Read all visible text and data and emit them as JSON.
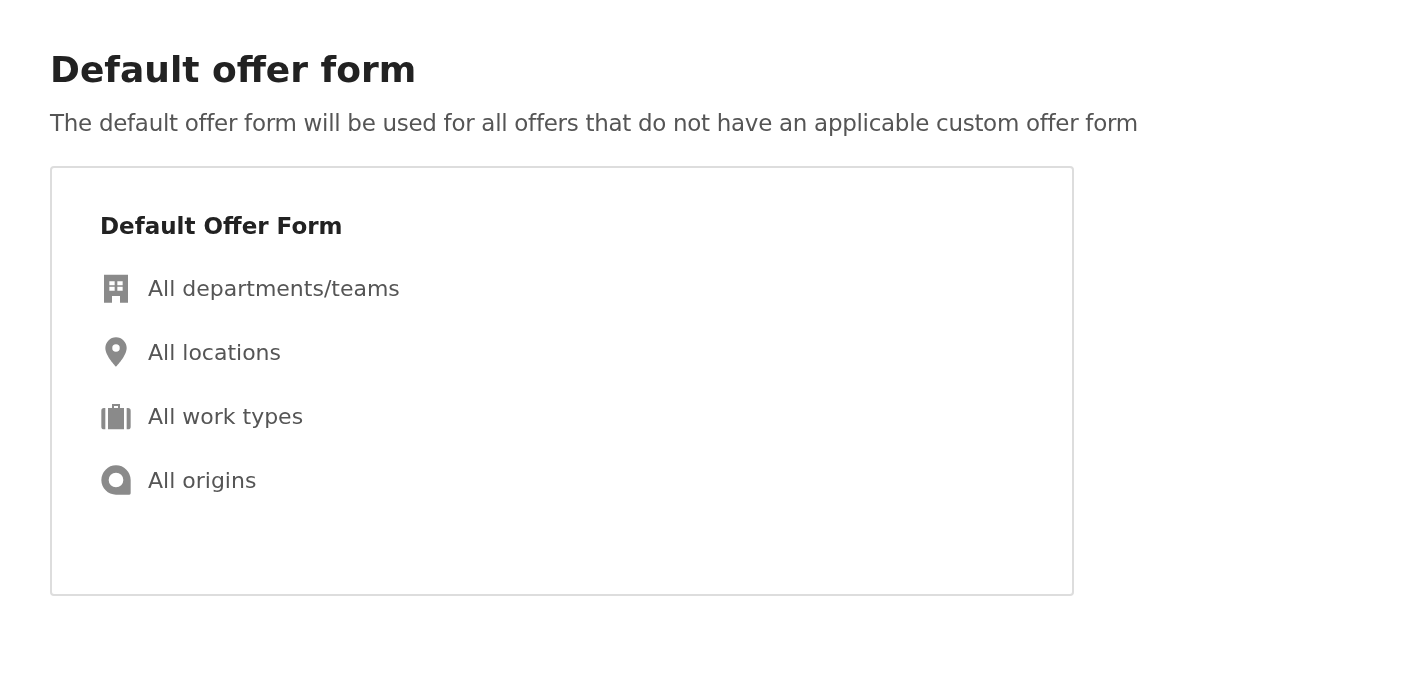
{
  "page": {
    "title": "Default offer form",
    "description": "The default offer form will be used for all offers that do not have an applicable custom offer form"
  },
  "card": {
    "title": "Default Offer Form",
    "items": [
      {
        "kind": "building",
        "label": "All departments/teams"
      },
      {
        "kind": "location",
        "label": "All locations"
      },
      {
        "kind": "briefcase",
        "label": "All work types"
      },
      {
        "kind": "origin",
        "label": "All origins"
      }
    ]
  }
}
